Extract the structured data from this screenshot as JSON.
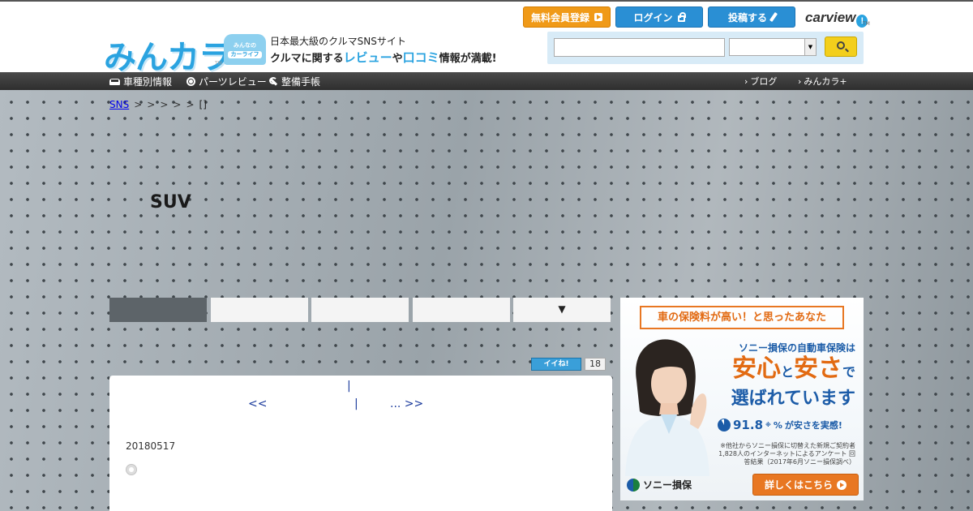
{
  "header": {
    "logo_text": "みんカラ",
    "logo_tm": "TM",
    "mascot_line1": "みんなの",
    "mascot_line2": "カーライフ",
    "tagline1": "日本最大級のクルマSNSサイト",
    "tagline2_a": "クルマに関する",
    "tagline2_review": "レビュー",
    "tagline2_b": "や",
    "tagline2_kuchikomi": "口コミ",
    "tagline2_c": "情報が満載!",
    "register_label": "無料会員登録",
    "login_label": "ログイン",
    "post_label": "投稿する",
    "carview_text": "carview",
    "carview_badge": "!",
    "carview_tm": "TM",
    "search_placeholder": "",
    "search_select_value": ""
  },
  "nav": {
    "left": [
      "車種別情報",
      "パーツレビュー",
      "整備手帳"
    ],
    "right": [
      "ブログ",
      "みんカラ+"
    ]
  },
  "breadcrumb": {
    "home": "SNS",
    "sep": ">",
    "current": "[]"
  },
  "page": {
    "title": "SUV"
  },
  "tabs": [
    "",
    "",
    "",
    "",
    "▼"
  ],
  "iine": {
    "label": "イイね!",
    "count": "18"
  },
  "post": {
    "pager_sep": "|",
    "pager_prev": "<<",
    "pager_next": "... >>",
    "date": "20180517"
  },
  "ad": {
    "headline": "車の保険料が高い！と思ったあなた",
    "sub": "ソニー損保の自動車保険は",
    "big1": "安心",
    "big_to": "と",
    "big2": "安さ",
    "big_de": "で",
    "big_line2": "選ばれています",
    "stat_pct": "91.8",
    "stat_mark": "※",
    "stat_unit": "%",
    "stat_text": "が安さを実感!",
    "note": "※他社からソニー損保に切替えた新規ご契約者 1,828人のインターネットによるアンケート 回答結果（2017年6月ソニー損保調べ）",
    "brand": "ソニー損保",
    "cta": "詳しくはこちら"
  },
  "colors": {
    "accent_blue": "#2aa3e0",
    "register_orange": "#f09a18",
    "nav_dark": "#333333",
    "ad_orange": "#e87722",
    "ad_blue": "#1c5ca8"
  }
}
